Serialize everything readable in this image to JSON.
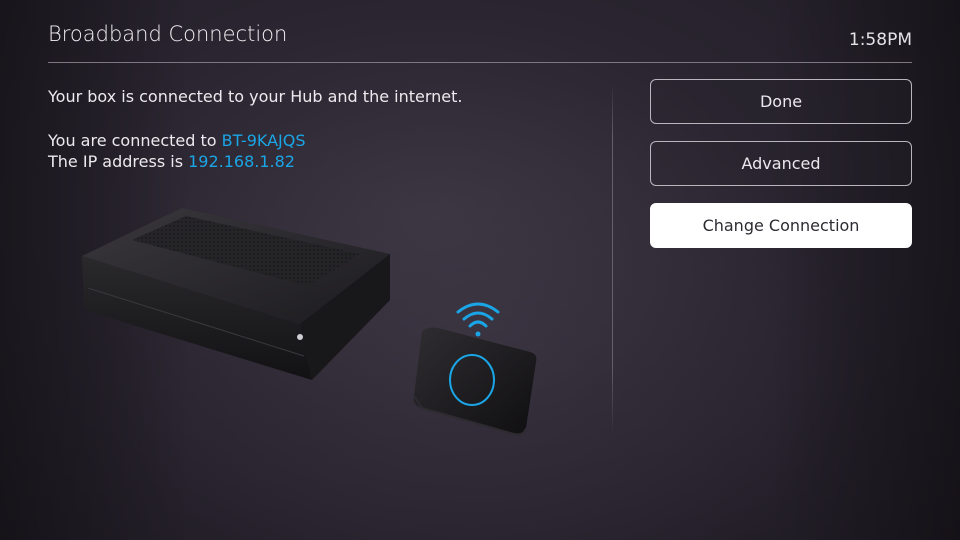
{
  "header": {
    "title": "Broadband Connection",
    "time": "1:58PM"
  },
  "status": {
    "line1": "Your box is connected to your Hub and the internet.",
    "connected_prefix": "You are connected to ",
    "network_name": "BT-9KAJQS",
    "ip_prefix": "The IP address is ",
    "ip_address": "192.168.1.82"
  },
  "menu": {
    "items": [
      {
        "label": "Done",
        "selected": false
      },
      {
        "label": "Advanced",
        "selected": false
      },
      {
        "label": "Change Connection",
        "selected": true
      }
    ]
  },
  "illustration": {
    "icons": [
      "tv-box-icon",
      "hub-icon",
      "wifi-icon"
    ],
    "accent_color": "#1aa6e6"
  }
}
